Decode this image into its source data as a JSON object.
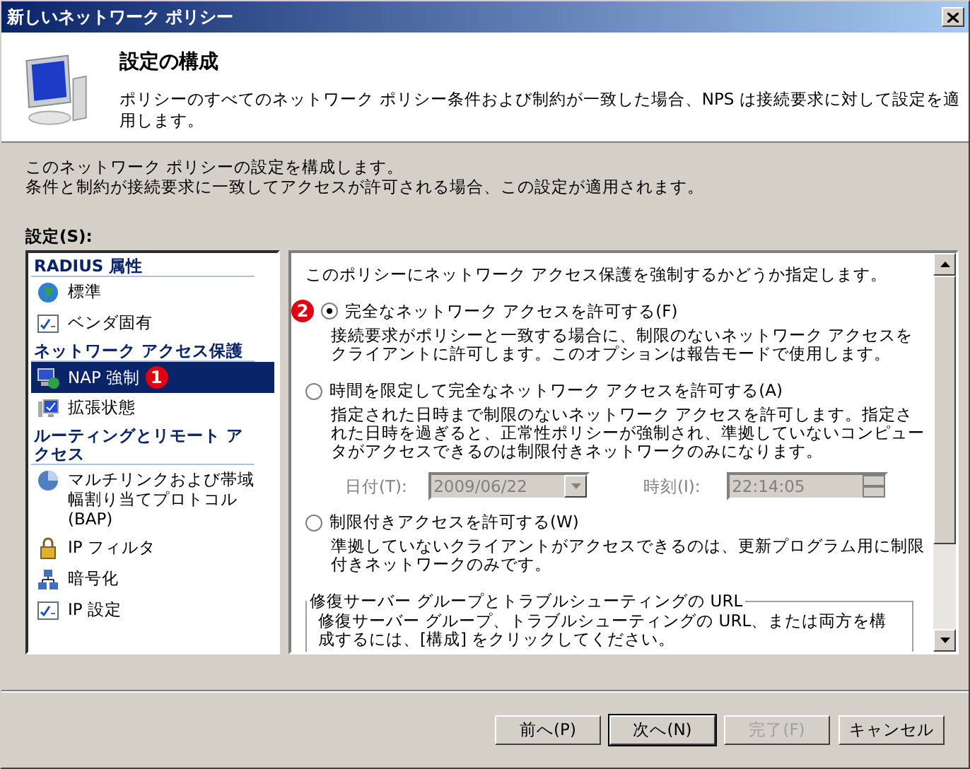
{
  "window": {
    "title": "新しいネットワーク ポリシー"
  },
  "header": {
    "title": "設定の構成",
    "description": "ポリシーのすべてのネットワーク ポリシー条件および制約が一致した場合、NPS は接続要求に対して設定を適用します。"
  },
  "intro": [
    "このネットワーク ポリシーの設定を構成します。",
    "条件と制約が接続要求に一致してアクセスが許可される場合、この設定が適用されます。"
  ],
  "settings_label": "設定(S):",
  "settings_list": [
    {
      "kind": "group",
      "label": "RADIUS 属性"
    },
    {
      "kind": "item",
      "label": "標準",
      "selected": false
    },
    {
      "kind": "item",
      "label": "ベンダ固有",
      "selected": false
    },
    {
      "kind": "group",
      "label": "ネットワーク アクセス保護"
    },
    {
      "kind": "item",
      "label": "NAP 強制",
      "selected": true,
      "callout": "1"
    },
    {
      "kind": "item",
      "label": "拡張状態",
      "selected": false
    },
    {
      "kind": "group",
      "label": "ルーティングとリモート アクセス"
    },
    {
      "kind": "item",
      "label": "マルチリンクおよび帯域幅割り当てプロトコル (BAP)",
      "selected": false
    },
    {
      "kind": "item",
      "label": "IP フィルタ",
      "selected": false
    },
    {
      "kind": "item",
      "label": "暗号化",
      "selected": false
    },
    {
      "kind": "item",
      "label": "IP 設定",
      "selected": false
    }
  ],
  "panel": {
    "prompt": "このポリシーにネットワーク アクセス保護を強制するかどうか指定します。",
    "options": [
      {
        "label": "完全なネットワーク アクセスを許可する(F)",
        "description": "接続要求がポリシーと一致する場合に、制限のないネットワーク アクセスをクライアントに許可します。このオプションは報告モードで使用します。",
        "selected": true,
        "callout": "2"
      },
      {
        "label": "時間を限定して完全なネットワーク アクセスを許可する(A)",
        "description": "指定された日時まで制限のないネットワーク アクセスを許可します。指定された日時を過ぎると、正常性ポリシーが強制され、準拠していないコンピュータがアクセスできるのは制限付きネットワークのみになります。",
        "selected": false
      },
      {
        "label": "制限付きアクセスを許可する(W)",
        "description": "準拠していないクライアントがアクセスできるのは、更新プログラム用に制限付きネットワークのみです。",
        "selected": false
      }
    ],
    "schedule": {
      "disabled": true,
      "date_label": "日付(T):",
      "date_value": "2009/06/22",
      "time_label": "時刻(I):",
      "time_value": "22:14:05"
    },
    "remediation": {
      "title": "修復サーバー グループとトラブルシューティングの URL",
      "text": "修復サーバー グループ、トラブルシューティングの URL、または両方を構成するには、[構成] をクリックしてください。"
    }
  },
  "buttons": [
    {
      "label": "前へ(P)",
      "disabled": false,
      "default": false
    },
    {
      "label": "次へ(N)",
      "disabled": false,
      "default": true
    },
    {
      "label": "完了(F)",
      "disabled": true,
      "default": false
    },
    {
      "label": "キャンセル",
      "disabled": false,
      "default": false
    }
  ]
}
